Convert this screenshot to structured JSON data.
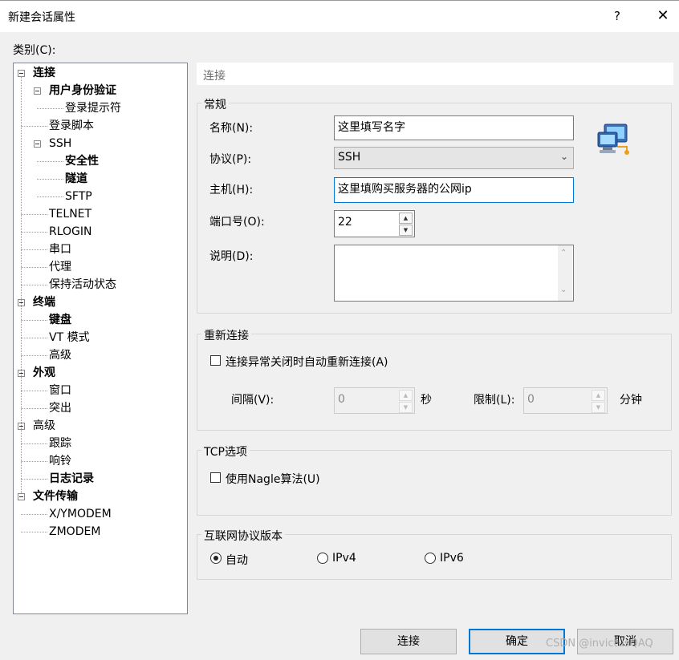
{
  "window": {
    "title": "新建会话属性",
    "help": "?",
    "close": "✕"
  },
  "category_label": "类别(C):",
  "tree": [
    {
      "label": "连接",
      "bold": true,
      "level": 0,
      "expanded": true
    },
    {
      "label": "用户身份验证",
      "bold": true,
      "level": 1,
      "expanded": true
    },
    {
      "label": "登录提示符",
      "bold": false,
      "level": 2
    },
    {
      "label": "登录脚本",
      "bold": false,
      "level": 1
    },
    {
      "label": "SSH",
      "bold": false,
      "level": 1,
      "expanded": true
    },
    {
      "label": "安全性",
      "bold": true,
      "level": 2
    },
    {
      "label": "隧道",
      "bold": true,
      "level": 2
    },
    {
      "label": "SFTP",
      "bold": false,
      "level": 2
    },
    {
      "label": "TELNET",
      "bold": false,
      "level": 1
    },
    {
      "label": "RLOGIN",
      "bold": false,
      "level": 1
    },
    {
      "label": "串口",
      "bold": false,
      "level": 1
    },
    {
      "label": "代理",
      "bold": false,
      "level": 1
    },
    {
      "label": "保持活动状态",
      "bold": false,
      "level": 1
    },
    {
      "label": "终端",
      "bold": true,
      "level": 0,
      "expanded": true
    },
    {
      "label": "键盘",
      "bold": true,
      "level": 1
    },
    {
      "label": "VT 模式",
      "bold": false,
      "level": 1
    },
    {
      "label": "高级",
      "bold": false,
      "level": 1
    },
    {
      "label": "外观",
      "bold": true,
      "level": 0,
      "expanded": true
    },
    {
      "label": "窗口",
      "bold": false,
      "level": 1
    },
    {
      "label": "突出",
      "bold": false,
      "level": 1
    },
    {
      "label": "高级",
      "bold": false,
      "level": 0,
      "expanded": true
    },
    {
      "label": "跟踪",
      "bold": false,
      "level": 1
    },
    {
      "label": "响铃",
      "bold": false,
      "level": 1
    },
    {
      "label": "日志记录",
      "bold": true,
      "level": 1
    },
    {
      "label": "文件传输",
      "bold": true,
      "level": 0,
      "expanded": true
    },
    {
      "label": "X/YMODEM",
      "bold": false,
      "level": 1
    },
    {
      "label": "ZMODEM",
      "bold": false,
      "level": 1
    }
  ],
  "panel_header": "连接",
  "general": {
    "legend": "常规",
    "name_label": "名称(N):",
    "name_value": "这里填写名字",
    "protocol_label": "协议(P):",
    "protocol_value": "SSH",
    "host_label": "主机(H):",
    "host_value": "这里填购买服务器的公网ip",
    "port_label": "端口号(O):",
    "port_value": "22",
    "desc_label": "说明(D):",
    "desc_value": ""
  },
  "reconnect": {
    "legend": "重新连接",
    "auto_label": "连接异常关闭时自动重新连接(A)",
    "auto_checked": false,
    "interval_label": "间隔(V):",
    "interval_value": "0",
    "interval_unit": "秒",
    "limit_label": "限制(L):",
    "limit_value": "0",
    "limit_unit": "分钟"
  },
  "tcp": {
    "legend": "TCP选项",
    "nagle_label": "使用Nagle算法(U)",
    "nagle_checked": false
  },
  "ipver": {
    "legend": "互联网协议版本",
    "options": [
      "自动",
      "IPv4",
      "IPv6"
    ],
    "selected": "自动"
  },
  "buttons": {
    "connect": "连接",
    "ok": "确定",
    "cancel": "取消"
  },
  "watermark": "CSDN @invictusQAQ",
  "colors": {
    "accent": "#0078d7",
    "window_bg": "#f0f0f0"
  }
}
